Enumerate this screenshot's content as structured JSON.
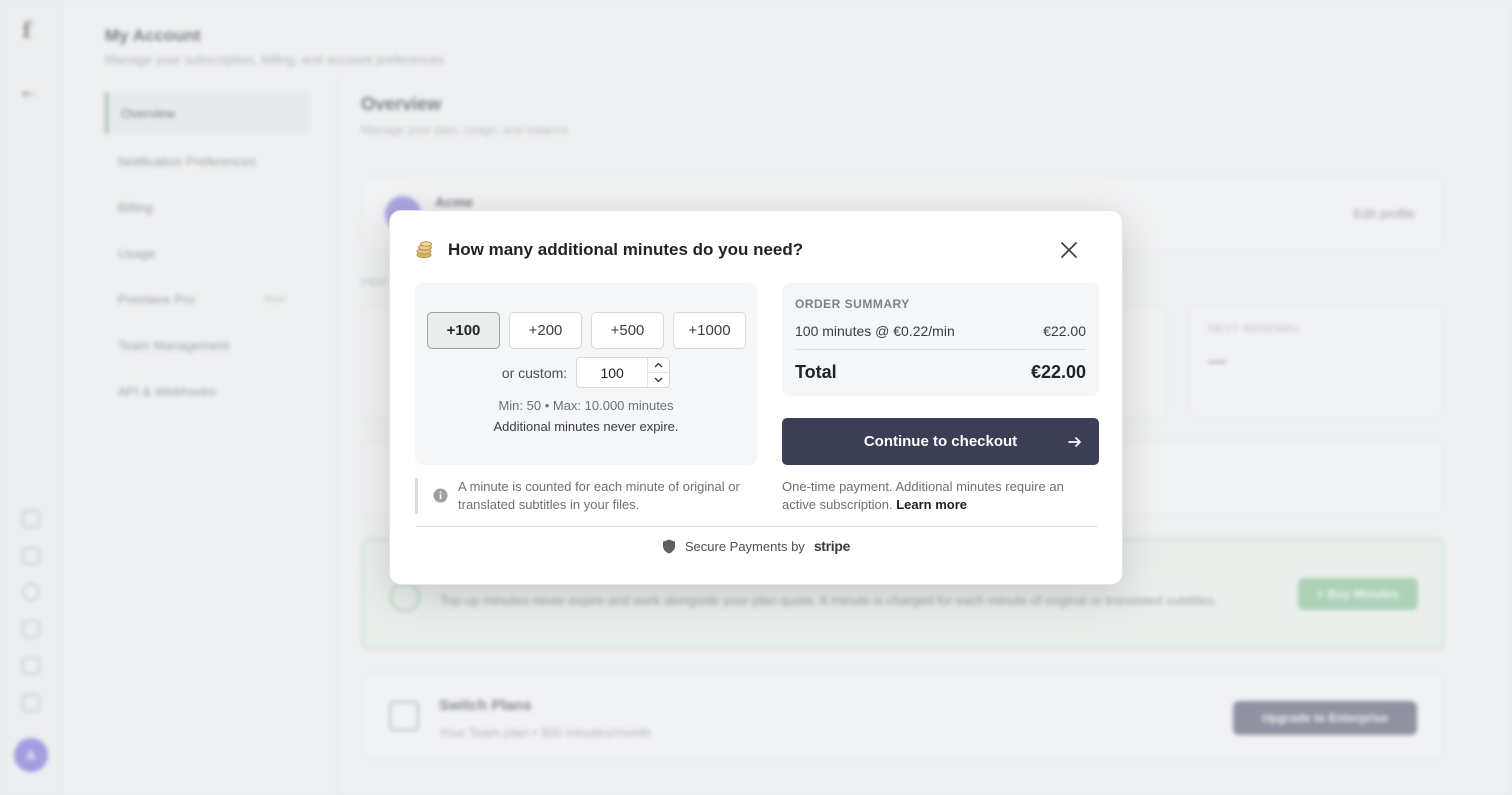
{
  "background": {
    "account_title": "My Account",
    "account_subtitle": "Manage your subscription, billing, and account preferences",
    "nav": [
      {
        "label": "Overview"
      },
      {
        "label": "Notification Preferences"
      },
      {
        "label": "Billing"
      },
      {
        "label": "Usage"
      },
      {
        "label": "Premiere Pro",
        "badge": "New!"
      },
      {
        "label": "Team Management"
      },
      {
        "label": "API & Webhooks"
      }
    ],
    "main_title": "Overview",
    "main_subtitle": "Manage your plan, usage, and balance",
    "profile_name": "Acme",
    "edit_profile": "Edit profile",
    "period_label": "PERI",
    "next_renewal_label": "NEXT RENEWAL",
    "next_renewal_value": "—",
    "topup_text": "Top-up minutes never expire and work alongside your plan quota. A minute is charged for each minute of original or translated subtitles.",
    "buy_minutes": "+ Buy Minutes",
    "switch_title": "Switch Plans",
    "switch_sub": "Your Team plan • 300 minutes/month",
    "upgrade_label": "Upgrade to Enterprise",
    "avatar_initial": "A"
  },
  "modal": {
    "title": "How many additional minutes do you need?",
    "presets": [
      "+100",
      "+200",
      "+500",
      "+1000"
    ],
    "selected_preset": "+100",
    "custom_label": "or custom:",
    "custom_value": "100",
    "limits": "Min: 50 • Max: 10.000 minutes",
    "never_expire": "Additional minutes never expire.",
    "info_note": "A minute is counted for each minute of original or translated subtitles in your files.",
    "order_summary_label": "ORDER SUMMARY",
    "line_item": "100 minutes @ €0.22/min",
    "line_amount": "€22.00",
    "total_label": "Total",
    "total_amount": "€22.00",
    "checkout_label": "Continue to checkout",
    "payment_note": "One-time payment. Additional minutes require an active subscription.",
    "learn_more": "Learn more",
    "secure_text": "Secure Payments by",
    "stripe": "stripe"
  },
  "colors": {
    "checkout_bg": "#3b3e54",
    "selected_preset_bg": "#e9edec",
    "panel_bg": "#f5f6f8"
  },
  "icons": {
    "header": "coins-icon",
    "close": "close-icon",
    "info": "info-icon",
    "arrow": "arrow-right-icon",
    "shield": "shield-icon"
  }
}
